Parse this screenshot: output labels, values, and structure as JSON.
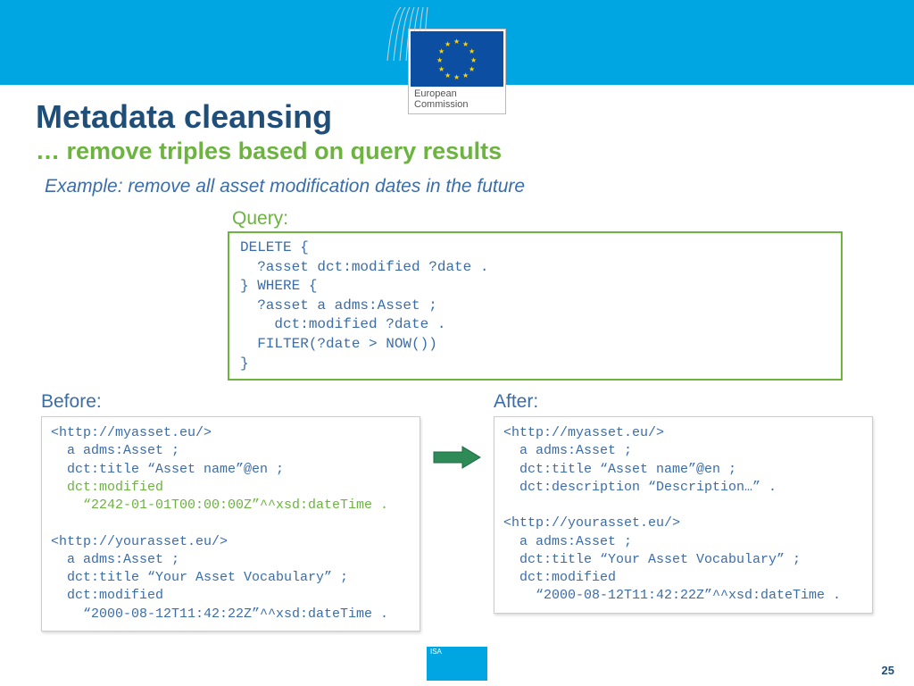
{
  "logo": {
    "line1": "European",
    "line2": "Commission"
  },
  "title": "Metadata cleansing",
  "subtitle": "… remove triples based on query results",
  "example": "Example: remove all asset modification dates in the future",
  "query_label": "Query:",
  "query_code": "DELETE {\n  ?asset dct:modified ?date .\n} WHERE {\n  ?asset a adms:Asset ;\n    dct:modified ?date .\n  FILTER(?date > NOW())\n}",
  "before_label": "Before:",
  "after_label": "After:",
  "before_pre": "<http://myasset.eu/>\n  a adms:Asset ;\n  dct:title “Asset name”@en ;\n  ",
  "before_hl": "dct:modified\n    “2242-01-01T00:00:00Z”^^xsd:dateTime .",
  "before_post": "\n\n<http://yourasset.eu/>\n  a adms:Asset ;\n  dct:title “Your Asset Vocabulary” ;\n  dct:modified\n    “2000-08-12T11:42:22Z”^^xsd:dateTime .",
  "after_code": "<http://myasset.eu/>\n  a adms:Asset ;\n  dct:title “Asset name”@en ;\n  dct:description “Description…” .\n\n<http://yourasset.eu/>\n  a adms:Asset ;\n  dct:title “Your Asset Vocabulary” ;\n  dct:modified\n    “2000-08-12T11:42:22Z”^^xsd:dateTime .",
  "isa": "ISA",
  "page_number": "25"
}
